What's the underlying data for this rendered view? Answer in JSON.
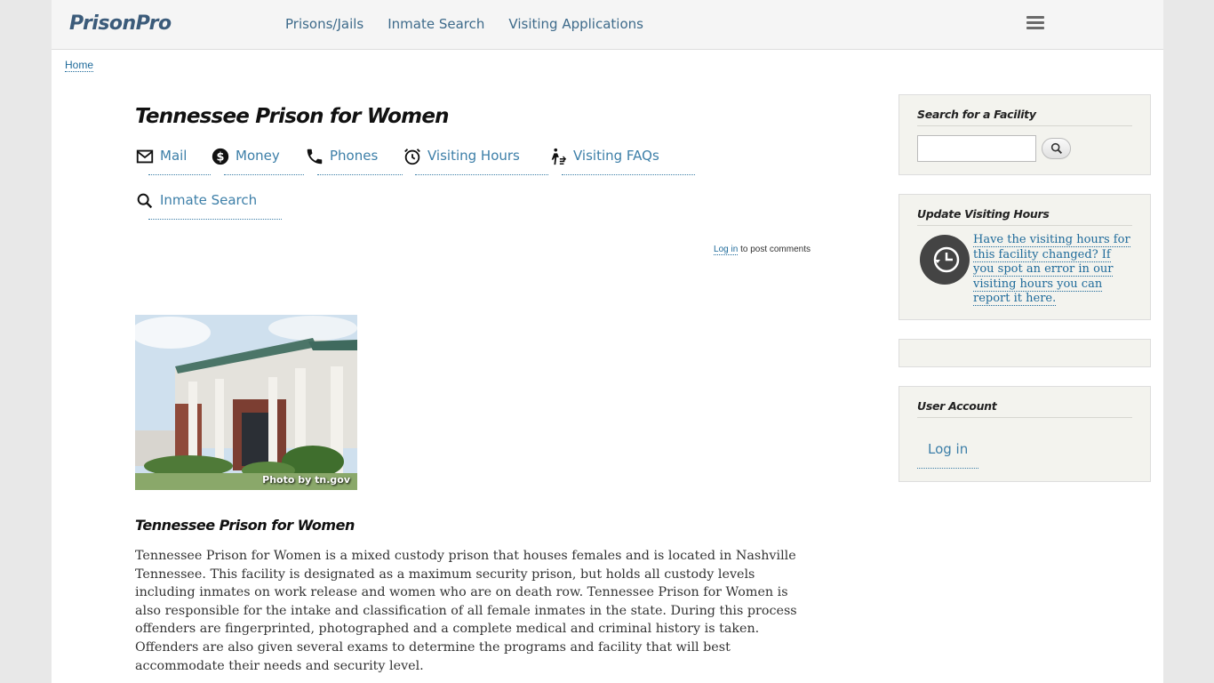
{
  "header": {
    "logo": "PrisonPro",
    "nav": [
      "Prisons/Jails",
      "Inmate Search",
      "Visiting Applications"
    ]
  },
  "breadcrumb": {
    "home": "Home"
  },
  "main": {
    "title": "Tennessee Prison for Women",
    "tabs": [
      {
        "label": "Mail",
        "icon": "mail-icon"
      },
      {
        "label": "Money",
        "icon": "money-icon"
      },
      {
        "label": "Phones",
        "icon": "phone-icon"
      },
      {
        "label": "Visiting Hours",
        "icon": "alarm-clock-icon"
      },
      {
        "label": "Visiting FAQs",
        "icon": "visitor-icon"
      },
      {
        "label": "Inmate Search",
        "icon": "search-icon"
      }
    ],
    "login_note": {
      "link": "Log in",
      "suffix": " to post comments"
    },
    "photo_credit": "Photo by tn.gov",
    "subtitle": "Tennessee Prison for Women",
    "body": "Tennessee Prison for Women is a mixed custody prison that houses females and is located in Nashville Tennessee.  This facility is designated as a maximum security prison, but holds all custody levels including inmates on work release and women who are on death row.  Tennessee Prison for Women is also responsible for the intake and classification of all female inmates in the state.  During this process offenders are fingerprinted, photographed and a complete medical and criminal history is taken.  Offenders are also given several exams to determine the programs and facility that will best accommodate their needs and security level."
  },
  "sidebar": {
    "search": {
      "title": "Search for a Facility",
      "placeholder": ""
    },
    "update": {
      "title": "Update Visiting Hours",
      "text": "Have the visiting hours for this facility changed?  If you spot an error in our visiting hours you can report it here."
    },
    "account": {
      "title": "User Account",
      "login": "Log in"
    }
  },
  "colors": {
    "link": "#3d7fa8",
    "logo": "#3b5b7a",
    "sidebar_bg": "#f3f3ee"
  }
}
